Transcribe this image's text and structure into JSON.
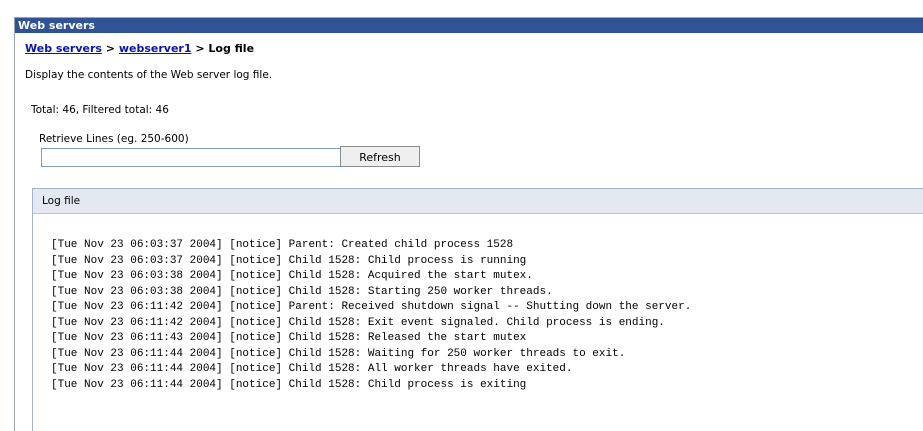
{
  "window": {
    "title": "Web servers"
  },
  "breadcrumb": {
    "link1": "Web servers",
    "sep1": " > ",
    "link2": "webserver1",
    "sep2": " > ",
    "current": "Log file"
  },
  "description": "Display the contents of the Web server log file.",
  "totals": "Total: 46, Filtered total: 46",
  "retrieve": {
    "label": "Retrieve Lines (eg. 250-600)",
    "value": "",
    "button": "Refresh"
  },
  "log": {
    "header": "Log file",
    "lines": [
      "[Tue Nov 23 06:03:37 2004] [notice] Parent: Created child process 1528",
      "[Tue Nov 23 06:03:37 2004] [notice] Child 1528: Child process is running",
      "[Tue Nov 23 06:03:38 2004] [notice] Child 1528: Acquired the start mutex.",
      "[Tue Nov 23 06:03:38 2004] [notice] Child 1528: Starting 250 worker threads.",
      "[Tue Nov 23 06:11:42 2004] [notice] Parent: Received shutdown signal -- Shutting down the server.",
      "[Tue Nov 23 06:11:42 2004] [notice] Child 1528: Exit event signaled. Child process is ending.",
      "[Tue Nov 23 06:11:43 2004] [notice] Child 1528: Released the start mutex",
      "[Tue Nov 23 06:11:44 2004] [notice] Child 1528: Waiting for 250 worker threads to exit.",
      "[Tue Nov 23 06:11:44 2004] [notice] Child 1528: All worker threads have exited.",
      "[Tue Nov 23 06:11:44 2004] [notice] Child 1528: Child process is exiting"
    ]
  }
}
